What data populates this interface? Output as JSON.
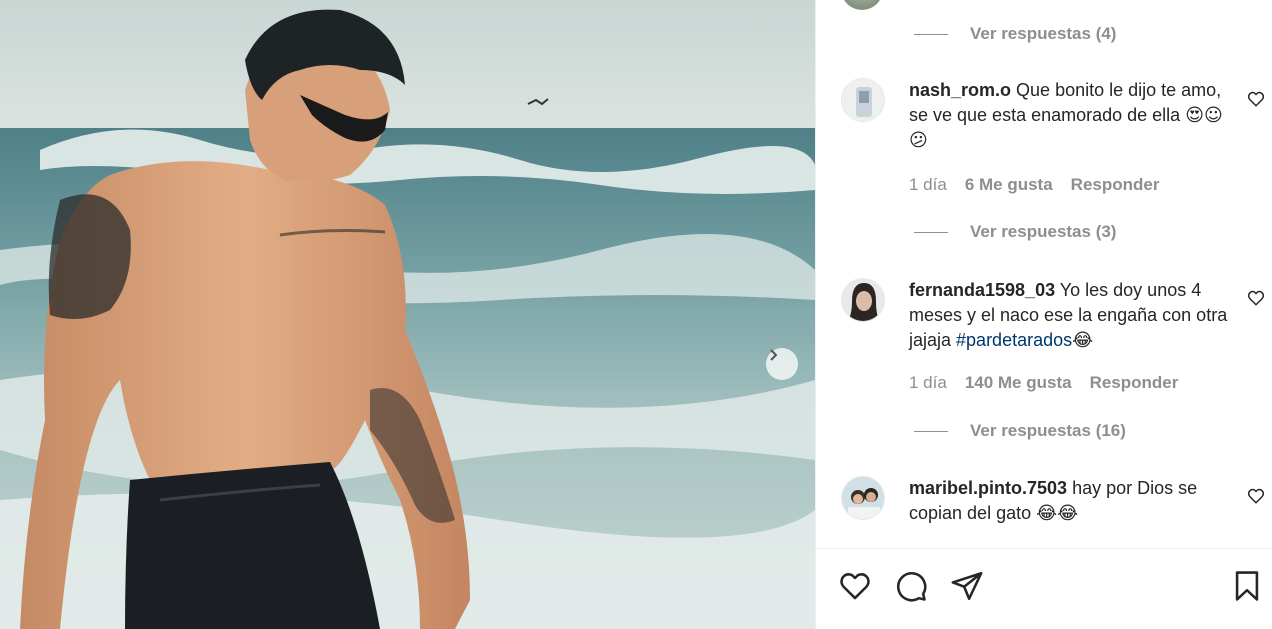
{
  "post_media": {
    "alt": "",
    "next_icon": "chevron-right-icon"
  },
  "comments": [
    {
      "username": "nash_rom.o",
      "text": "Que bonito le dijo te amo, se ve que esta enamorado de ella ",
      "emojis": "😍☺😕",
      "time": "1 día",
      "likes": "6 Me gusta",
      "reply": "Responder",
      "view_replies": "Ver respuestas (3)"
    },
    {
      "username": "fernanda1598_03",
      "text": "Yo les doy unos 4 meses y el naco ese la engaña con otra jajaja ",
      "hashtag": "#pardetarados",
      "emojis": "😂",
      "time": "1 día",
      "likes": "140 Me gusta",
      "reply": "Responder",
      "view_replies": "Ver respuestas (16)"
    },
    {
      "username": "maribel.pinto.7503",
      "text": "hay por Dios se copian del gato ",
      "emojis": "😂😂"
    }
  ],
  "previous_view_replies": "Ver respuestas (4)",
  "actions": {
    "like_icon": "heart-icon",
    "comment_icon": "comment-icon",
    "share_icon": "send-icon",
    "save_icon": "bookmark-icon"
  },
  "colors": {
    "muted": "#8e8e8e",
    "text": "#262626",
    "hashtag": "#00376b"
  }
}
